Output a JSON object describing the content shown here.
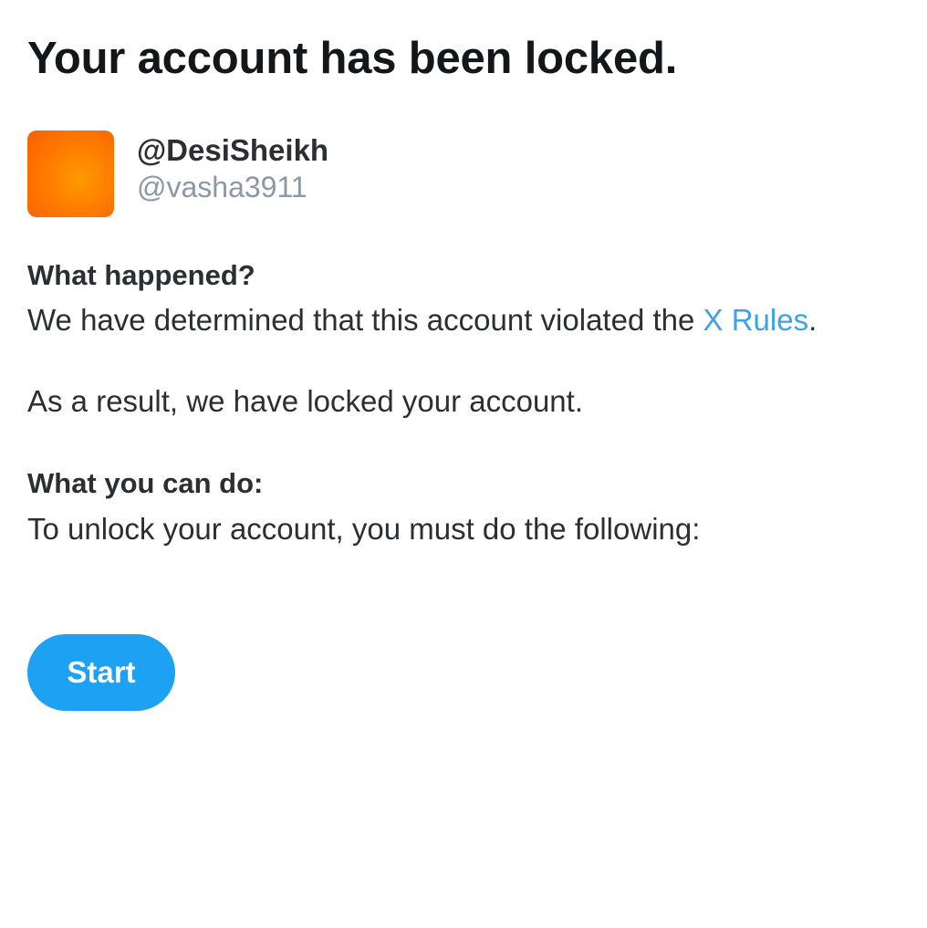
{
  "header": {
    "title": "Your account has been locked."
  },
  "account": {
    "display_name": "@DesiSheikh",
    "handle": "@vasha3911"
  },
  "what_happened": {
    "heading": "What happened?",
    "line_prefix": "We have determined that this account violated the ",
    "rules_link": "X Rules",
    "line_suffix": ".",
    "result": "As a result, we have locked your account."
  },
  "what_you_can_do": {
    "heading": "What you can do:",
    "instruction": "To unlock your account, you must do the following:"
  },
  "actions": {
    "start_label": "Start"
  },
  "colors": {
    "accent": "#1da1f2",
    "link": "#3ea2e6",
    "text": "#2b2f33",
    "muted": "#8b98a5",
    "avatar": "#ff8800"
  }
}
